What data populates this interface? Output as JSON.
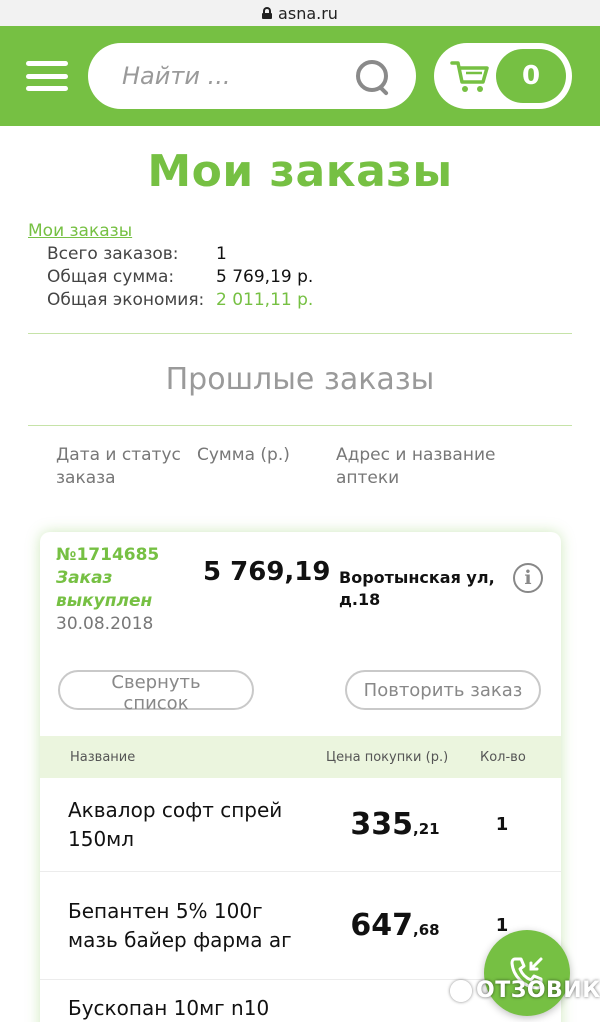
{
  "browser": {
    "url": "asna.ru"
  },
  "header": {
    "search_placeholder": "Найти ...",
    "cart_count": "0"
  },
  "page_title": "Мои заказы",
  "summary": {
    "link": "Мои заказы",
    "total_orders_label": "Всего заказов:",
    "total_orders_value": "1",
    "total_sum_label": "Общая сумма:",
    "total_sum_value": "5 769,19 р.",
    "savings_label": "Общая экономия:",
    "savings_value": "2 011,11 р."
  },
  "past_orders_title": "Прошлые заказы",
  "columns": {
    "date_status": "Дата и статус заказа",
    "sum": "Сумма (р.)",
    "address": "Адрес и название аптеки"
  },
  "order": {
    "number": "№1714685",
    "status": "Заказ выкуплен",
    "date": "30.08.2018",
    "sum": "5 769,19",
    "address": "Воротынская ул, д.18",
    "collapse_button": "Свернуть список",
    "repeat_button": "Повторить заказ"
  },
  "items_header": {
    "name": "Название",
    "price": "Цена покупки (р.)",
    "qty": "Кол-во"
  },
  "items": [
    {
      "name": "Аквалор софт спрей 150мл",
      "price_int": "335",
      "price_dec": ",21",
      "qty": "1"
    },
    {
      "name": "Бепантен 5% 100г мазь байер фарма аг",
      "price_int": "647",
      "price_dec": ",68",
      "qty": "1"
    },
    {
      "name": "Бускопан 10мг n10",
      "price_int": "",
      "price_dec": "",
      "qty": ""
    }
  ],
  "watermark": "ОТЗОВИК",
  "colors": {
    "brand_green": "#76c043"
  }
}
